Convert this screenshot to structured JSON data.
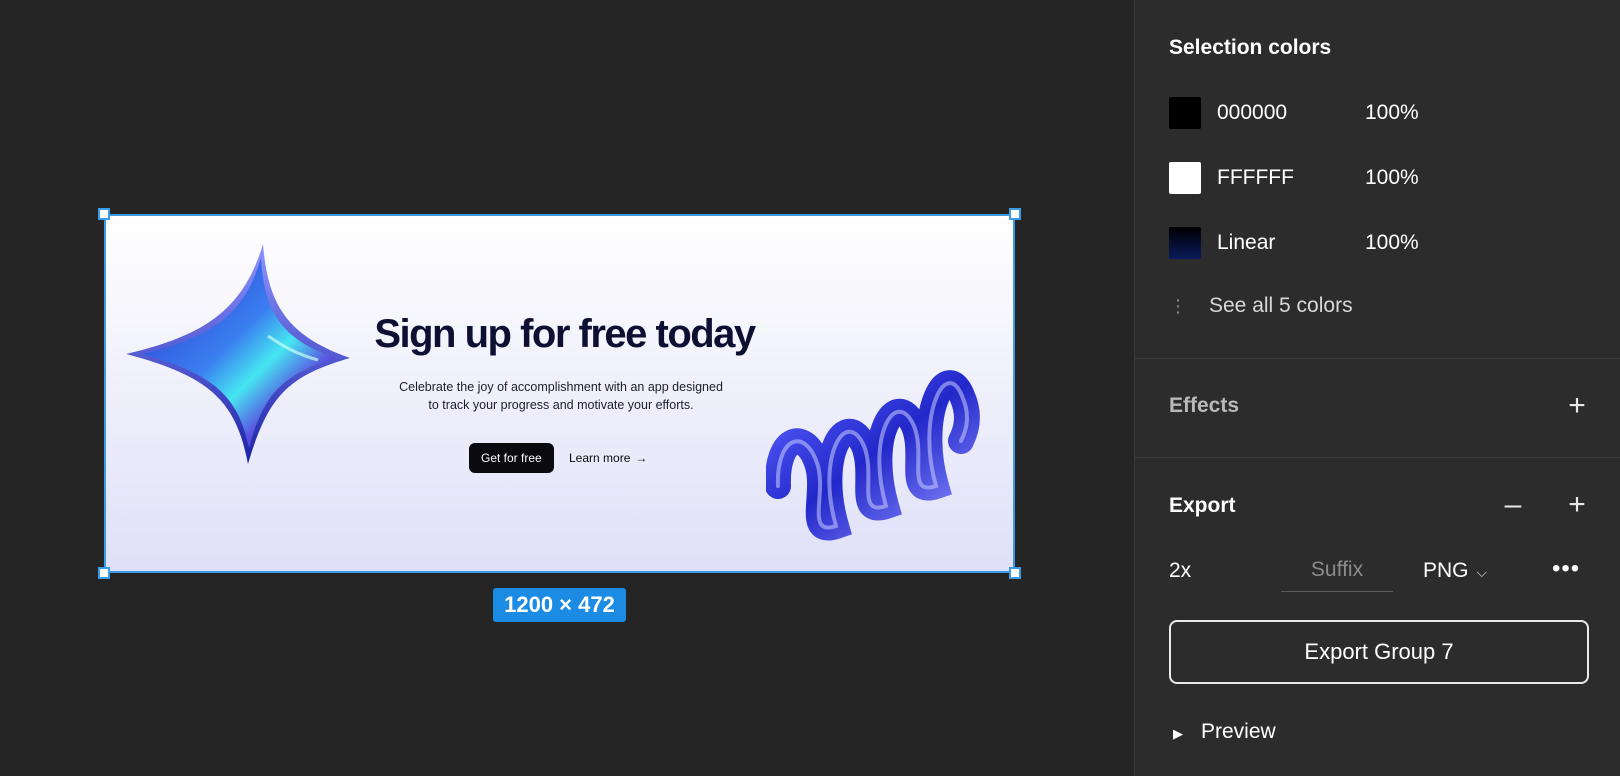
{
  "canvas": {
    "size_label": "1200 × 472",
    "banner": {
      "title": "Sign up for free today",
      "text_line1": "Celebrate the joy of accomplishment with an app designed",
      "text_line2": "to track your progress and motivate your efforts.",
      "cta": "Get for free",
      "learn_more": "Learn more",
      "arrow": "→"
    }
  },
  "panel": {
    "selection_colors": {
      "title": "Selection colors",
      "items": [
        {
          "name": "000000",
          "opacity": "100%",
          "color": "#000000"
        },
        {
          "name": "FFFFFF",
          "opacity": "100%",
          "color": "#FFFFFF"
        },
        {
          "name": "Linear",
          "opacity": "100%",
          "color": "#0a1a5c"
        }
      ],
      "see_all": "See all 5 colors"
    },
    "effects": {
      "title": "Effects"
    },
    "export": {
      "title": "Export",
      "scale": "2x",
      "suffix_placeholder": "Suffix",
      "format": "PNG",
      "button": "Export Group 7",
      "preview": "Preview"
    }
  }
}
